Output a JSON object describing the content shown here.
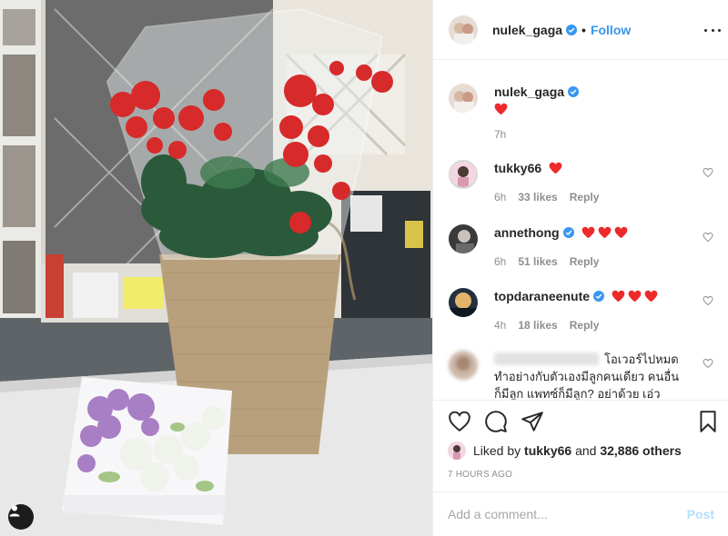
{
  "photo": {
    "alt_icon": "person-tag-icon"
  },
  "header": {
    "username": "nulek_gaga",
    "separator": "•",
    "follow_label": "Follow",
    "more_icon": "more-dots-icon"
  },
  "caption": {
    "username": "nulek_gaga",
    "text_icon": "red-heart-emoji",
    "time": "7h"
  },
  "comments": [
    {
      "username": "tukky66",
      "hearts": 1,
      "time": "6h",
      "likes": "33 likes",
      "reply": "Reply"
    },
    {
      "username": "annethong",
      "hearts": 3,
      "time": "6h",
      "likes": "51 likes",
      "reply": "Reply"
    },
    {
      "username": "topdaraneenute",
      "hearts": 3,
      "time": "4h",
      "likes": "18 likes",
      "reply": "Reply"
    },
    {
      "text_line1": "โอเวอร์ไปหมด",
      "text_line2": "ทำอย่างกับตัวเองมีลูกคนเดียว คนอื่น",
      "text_line3": "ก็มีลูก แพทซ์ก็มีลูก? อย่าด้วย เอ่ว"
    }
  ],
  "liked": {
    "prefix": "Liked by",
    "user": "tukky66",
    "and": "and",
    "others": "32,886 others"
  },
  "timestamp": "7 HOURS AGO",
  "add_comment": {
    "placeholder": "Add a comment...",
    "post_label": "Post"
  },
  "colors": {
    "link_blue": "#3897f0",
    "post_disabled": "#b2dffc",
    "heart_red": "#ed4956",
    "verified_blue": "#3897f0"
  }
}
